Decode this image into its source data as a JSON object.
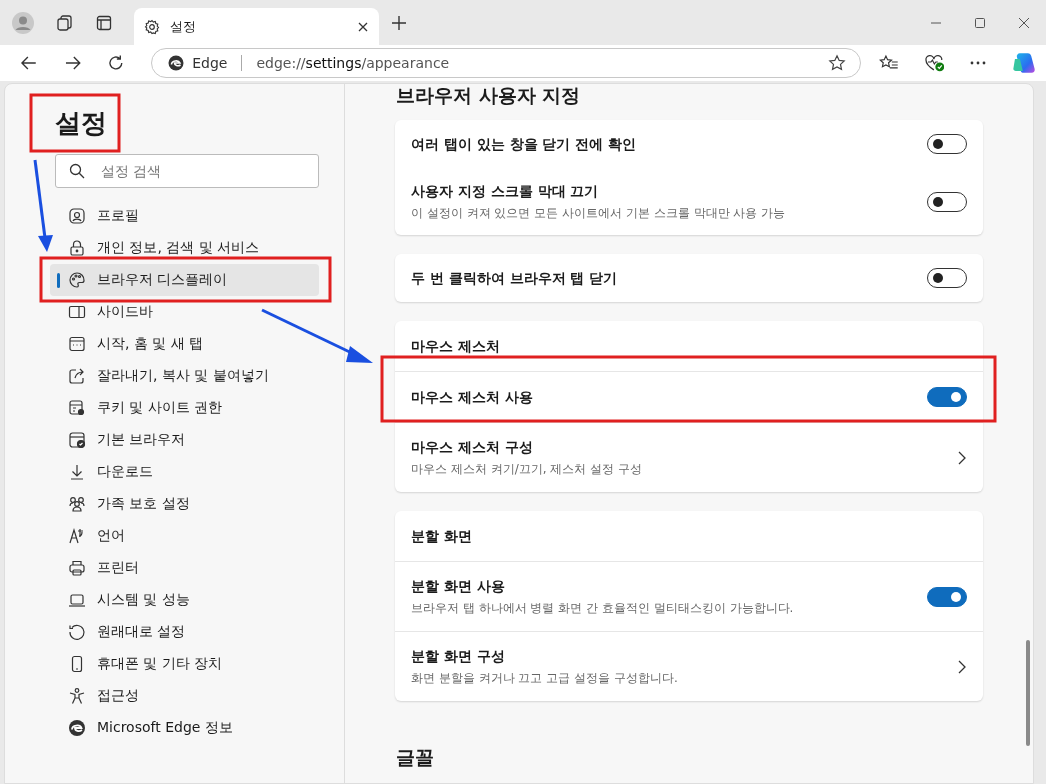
{
  "browser": {
    "tabs": [
      {
        "title": "설정",
        "selected": true
      }
    ],
    "address": {
      "site_label": "Edge",
      "url_scheme": "edge://",
      "url_host": "settings",
      "url_path": "/appearance"
    }
  },
  "sidebar": {
    "title": "설정",
    "search": {
      "placeholder": "설정 검색"
    },
    "items": [
      {
        "label": "프로필",
        "selected": false
      },
      {
        "label": "개인 정보, 검색 및 서비스",
        "selected": false
      },
      {
        "label": "브라우저 디스플레이",
        "selected": true
      },
      {
        "label": "사이드바",
        "selected": false
      },
      {
        "label": "시작, 홈 및 새 탭",
        "selected": false
      },
      {
        "label": "잘라내기, 복사 및 붙여넣기",
        "selected": false
      },
      {
        "label": "쿠키 및 사이트 권한",
        "selected": false
      },
      {
        "label": "기본 브라우저",
        "selected": false
      },
      {
        "label": "다운로드",
        "selected": false
      },
      {
        "label": "가족 보호 설정",
        "selected": false
      },
      {
        "label": "언어",
        "selected": false
      },
      {
        "label": "프린터",
        "selected": false
      },
      {
        "label": "시스템 및 성능",
        "selected": false
      },
      {
        "label": "원래대로 설정",
        "selected": false
      },
      {
        "label": "휴대폰 및 기타 장치",
        "selected": false
      },
      {
        "label": "접근성",
        "selected": false
      },
      {
        "label": "Microsoft Edge 정보",
        "selected": false
      }
    ]
  },
  "content": {
    "section_title": "브라우저 사용자 지정",
    "cards": [
      {
        "divided": false,
        "rows": [
          {
            "kind": "toggle",
            "label": "여러 탭이 있는 창을 닫기 전에 확인",
            "on": false
          },
          {
            "kind": "toggle",
            "label": "사용자 지정 스크롤 막대 끄기",
            "description": "이 설정이 켜져 있으면 모든 사이트에서 기본 스크롤 막대만 사용 가능",
            "on": false
          }
        ]
      },
      {
        "divided": false,
        "rows": [
          {
            "kind": "toggle",
            "label": "두 번 클릭하여 브라우저 탭 닫기",
            "on": false
          }
        ]
      },
      {
        "divided": true,
        "rows": [
          {
            "kind": "heading",
            "label": "마우스 제스처"
          },
          {
            "kind": "toggle",
            "label": "마우스 제스처 사용",
            "on": true
          },
          {
            "kind": "link",
            "label": "마우스 제스처 구성",
            "description": "마우스 제스처 켜기/끄기, 제스처 설정 구성"
          }
        ]
      },
      {
        "divided": true,
        "rows": [
          {
            "kind": "heading",
            "label": "분할 화면"
          },
          {
            "kind": "toggle",
            "label": "분할 화면 사용",
            "description": "브라우저 탭 하나에서 병렬 화면 간 효율적인 멀티태스킹이 가능합니다.",
            "on": true
          },
          {
            "kind": "link",
            "label": "분할 화면 구성",
            "description": "화면 분할을 켜거나 끄고 고급 설정을 구성합니다."
          }
        ]
      }
    ],
    "next_section_title": "글꼴"
  }
}
